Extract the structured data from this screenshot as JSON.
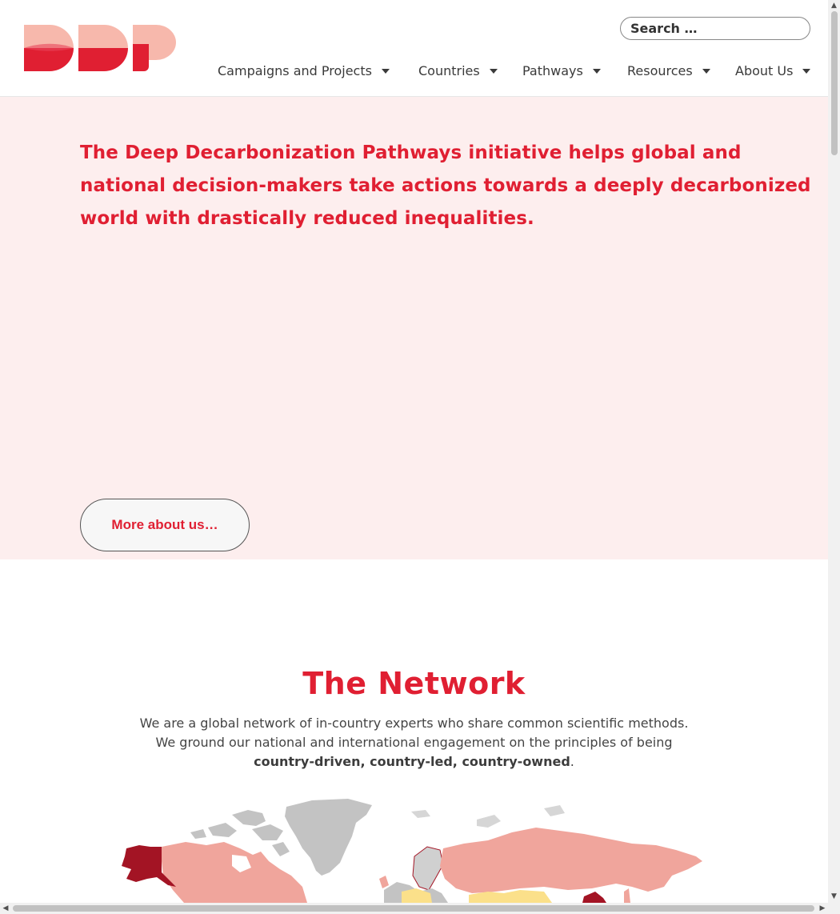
{
  "header": {
    "search": {
      "placeholder": "Search …"
    },
    "nav": [
      {
        "label": "Campaigns and Projects"
      },
      {
        "label": "Countries"
      },
      {
        "label": "Pathways"
      },
      {
        "label": "Resources"
      },
      {
        "label": "About Us"
      }
    ]
  },
  "hero": {
    "text": "The Deep Decarbonization Pathways initiative helps global and national decision-makers take actions towards a deeply decarbonized world with drastically reduced inequalities.",
    "button": "More about us…"
  },
  "network": {
    "title": "The Network",
    "line1": "We are a global network of in-country experts who share common scientific methods.",
    "line2": "We ground our national and international engagement on the principles of being",
    "bold": "country-driven, country-led, country-owned",
    "end": "."
  },
  "colors": {
    "brand_red": "#e01f32",
    "brand_pink": "#f7b8ac",
    "hero_bg": "#fdeeee",
    "map_dark": "#a31424",
    "map_salmon": "#f0a59c",
    "map_grey": "#c3c3c3",
    "map_yellow": "#fbe08a"
  },
  "icons": {
    "logo": "ddp-logo",
    "caret": "caret-down-icon",
    "map": "world-map"
  }
}
